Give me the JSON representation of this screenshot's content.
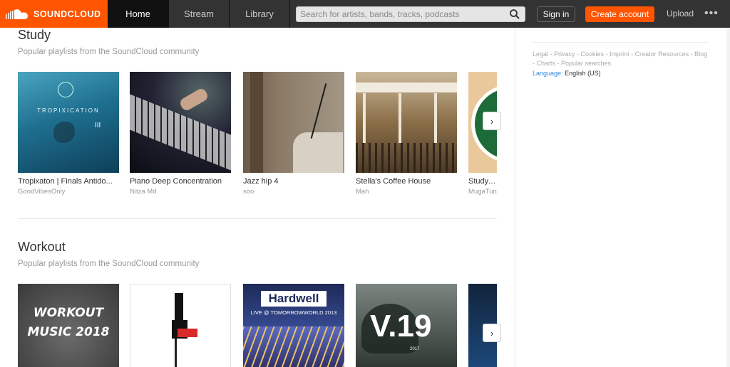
{
  "header": {
    "logo_text": "SOUNDCLOUD",
    "tabs": [
      "Home",
      "Stream",
      "Library"
    ],
    "search_placeholder": "Search for artists, bands, tracks, podcasts",
    "signin": "Sign in",
    "create": "Create account",
    "upload": "Upload",
    "more": "•••"
  },
  "sections": [
    {
      "title": "Study",
      "subtitle": "Popular playlists from the SoundCloud community",
      "cards": [
        {
          "title": "Tropixaton | Finals Antido...",
          "user": "GoodVibesOnly",
          "art_text": "TROPIXICATION"
        },
        {
          "title": "Piano Deep Concentration",
          "user": "Nitza Md"
        },
        {
          "title": "Jazz hip 4",
          "user": "soo"
        },
        {
          "title": "Stella's Coffee House",
          "user": "Mah"
        },
        {
          "title": "Study, C",
          "user": "MugaTun"
        }
      ]
    },
    {
      "title": "Workout",
      "subtitle": "Popular playlists from the SoundCloud community",
      "cards": [
        {
          "art_text": "WORKOUT MUSIC 2018"
        },
        {},
        {
          "art_text": "Hardwell",
          "art_sub": "LIVE @ TOMORROWWORLD 2013"
        },
        {
          "art_text": "V.19",
          "art_sub": "2017"
        },
        {}
      ]
    }
  ],
  "sidebar": {
    "links": [
      "Legal",
      "Privacy",
      "Cookies",
      "Imprint",
      "Creator Resources",
      "Blog",
      "Charts",
      "Popular searches"
    ],
    "language_label": "Language:",
    "language_value": "English (US)"
  },
  "colors": {
    "brand": "#ff5500",
    "header_bg": "#333333"
  }
}
